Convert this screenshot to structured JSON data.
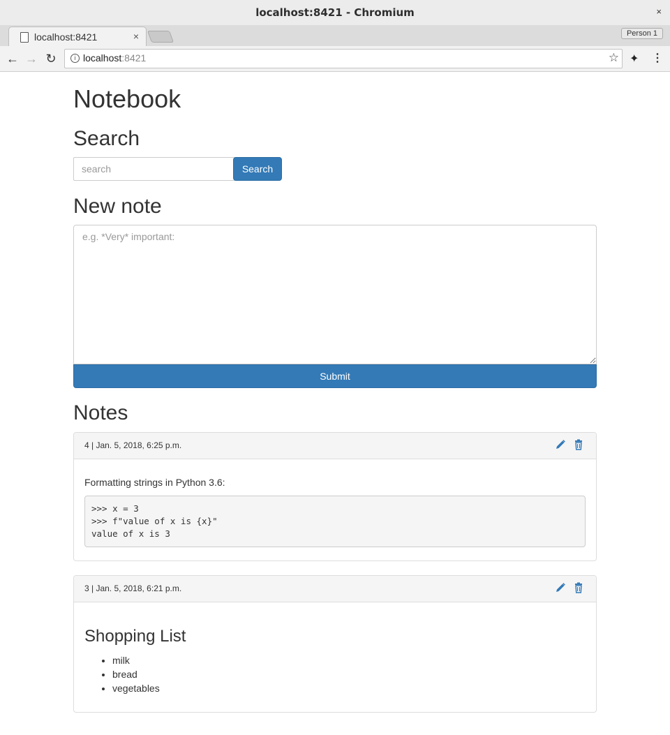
{
  "window": {
    "title": "localhost:8421 - Chromium",
    "close_glyph": "×"
  },
  "tab": {
    "label": "localhost:8421",
    "close_glyph": "×"
  },
  "profile": {
    "label": "Person 1"
  },
  "omnibox": {
    "host": "localhost",
    "port": ":8421"
  },
  "page": {
    "title": "Notebook",
    "search_heading": "Search",
    "search_placeholder": "search",
    "search_button": "Search",
    "new_note_heading": "New note",
    "new_note_placeholder": "e.g. *Very* important:",
    "submit_button": "Submit",
    "notes_heading": "Notes"
  },
  "notes": [
    {
      "meta": "4 | Jan. 5, 2018, 6:25 p.m.",
      "text": "Formatting strings in Python 3.6:",
      "code": ">>> x = 3\n>>> f\"value of x is {x}\"\nvalue of x is 3"
    },
    {
      "meta": "3 | Jan. 5, 2018, 6:21 p.m.",
      "heading": "Shopping List",
      "items": [
        "milk",
        "bread",
        "vegetables"
      ]
    }
  ],
  "colors": {
    "primary": "#337ab7",
    "panel_head": "#f5f5f5",
    "border": "#dddddd"
  },
  "icons": [
    "back-icon",
    "forward-icon",
    "reload-icon",
    "info-icon",
    "star-icon",
    "extension-icon",
    "menu-icon",
    "edit-icon",
    "trash-icon"
  ]
}
